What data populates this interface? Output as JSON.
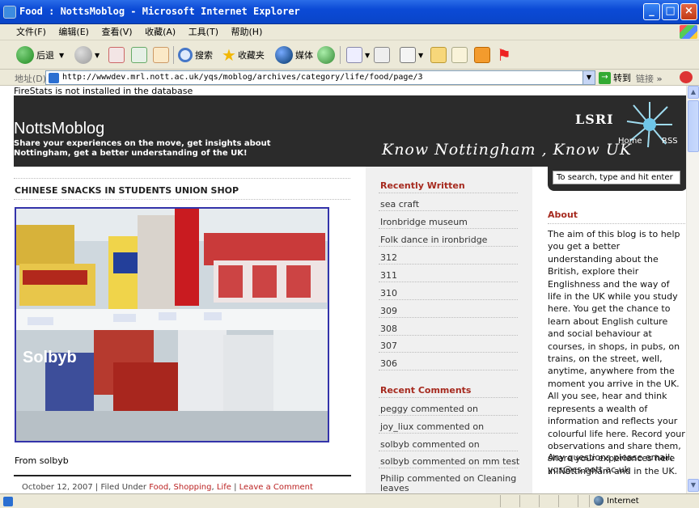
{
  "window": {
    "title": "Food : NottsMoblog - Microsoft Internet Explorer",
    "minimize": "_",
    "maximize": "□",
    "close": "×"
  },
  "menu": [
    "文件(F)",
    "编辑(E)",
    "查看(V)",
    "收藏(A)",
    "工具(T)",
    "帮助(H)"
  ],
  "toolbar": {
    "back": "后退",
    "search": "搜索",
    "favorites": "收藏夹",
    "media": "媒体"
  },
  "address": {
    "label": "地址(D)",
    "url": "http://wwwdev.mrl.nott.ac.uk/yqs/moblog/archives/category/life/food/page/3",
    "go": "转到",
    "links": "链接",
    "more": "»"
  },
  "page": {
    "firestats": "FireStats is not installed in the database",
    "site_name": "NottsMoblog",
    "tagline": "Share your experiences on the move, get insights about Nottingham, get a better understanding of the UK!",
    "slogan": "Know Nottingham , Know UK",
    "logo": "LSRI",
    "nav_home": "Home",
    "nav_rss": "RSS",
    "search_placeholder": "To search, type and hit enter",
    "post": {
      "title": "CHINESE SNACKS IN STUDENTS UNION SHOP",
      "image_watermark": "Solbyb",
      "from": "From solbyb",
      "date": "October 12, 2007",
      "filed_under": "| Filed Under",
      "cat1": "Food",
      "cat2": "Shopping",
      "cat3": "Life",
      "sep": "|",
      "comment_link": "Leave a Comment"
    },
    "recently_written": {
      "heading": "Recently Written",
      "items": [
        "sea craft",
        "Ironbridge museum",
        "Folk dance in ironbridge",
        "312",
        "311",
        "310",
        "309",
        "308",
        "307",
        "306"
      ]
    },
    "recent_comments": {
      "heading": "Recent Comments",
      "items": [
        "peggy commented on",
        "joy_liux commented on",
        "solbyb commented on",
        "solbyb commented on mm test",
        "Philip commented on Cleaning leaves"
      ]
    },
    "about": {
      "heading": "About",
      "text": "The aim of this blog is to help you get a better understanding about the British, explore their Englishness and the way of life in the UK while you study here. You get the chance to learn about English culture and social behaviour at courses, in shops, in pubs, on trains, on the street, well, anytime, anywhere from the moment you arrive in the UK. All you see, hear and think represents a wealth of information and reflects your colourful life here. Record your observations and share them, share your experiences here in Nottingham and in the UK.",
      "email_text": "Any questions please email: yqs@cs.nott.ac.uk"
    }
  },
  "status": {
    "zone": "Internet"
  },
  "colors": {
    "accent": "#a62a1f",
    "header_bg": "#2b2b2b",
    "title_bar": "#0b4ad6"
  }
}
